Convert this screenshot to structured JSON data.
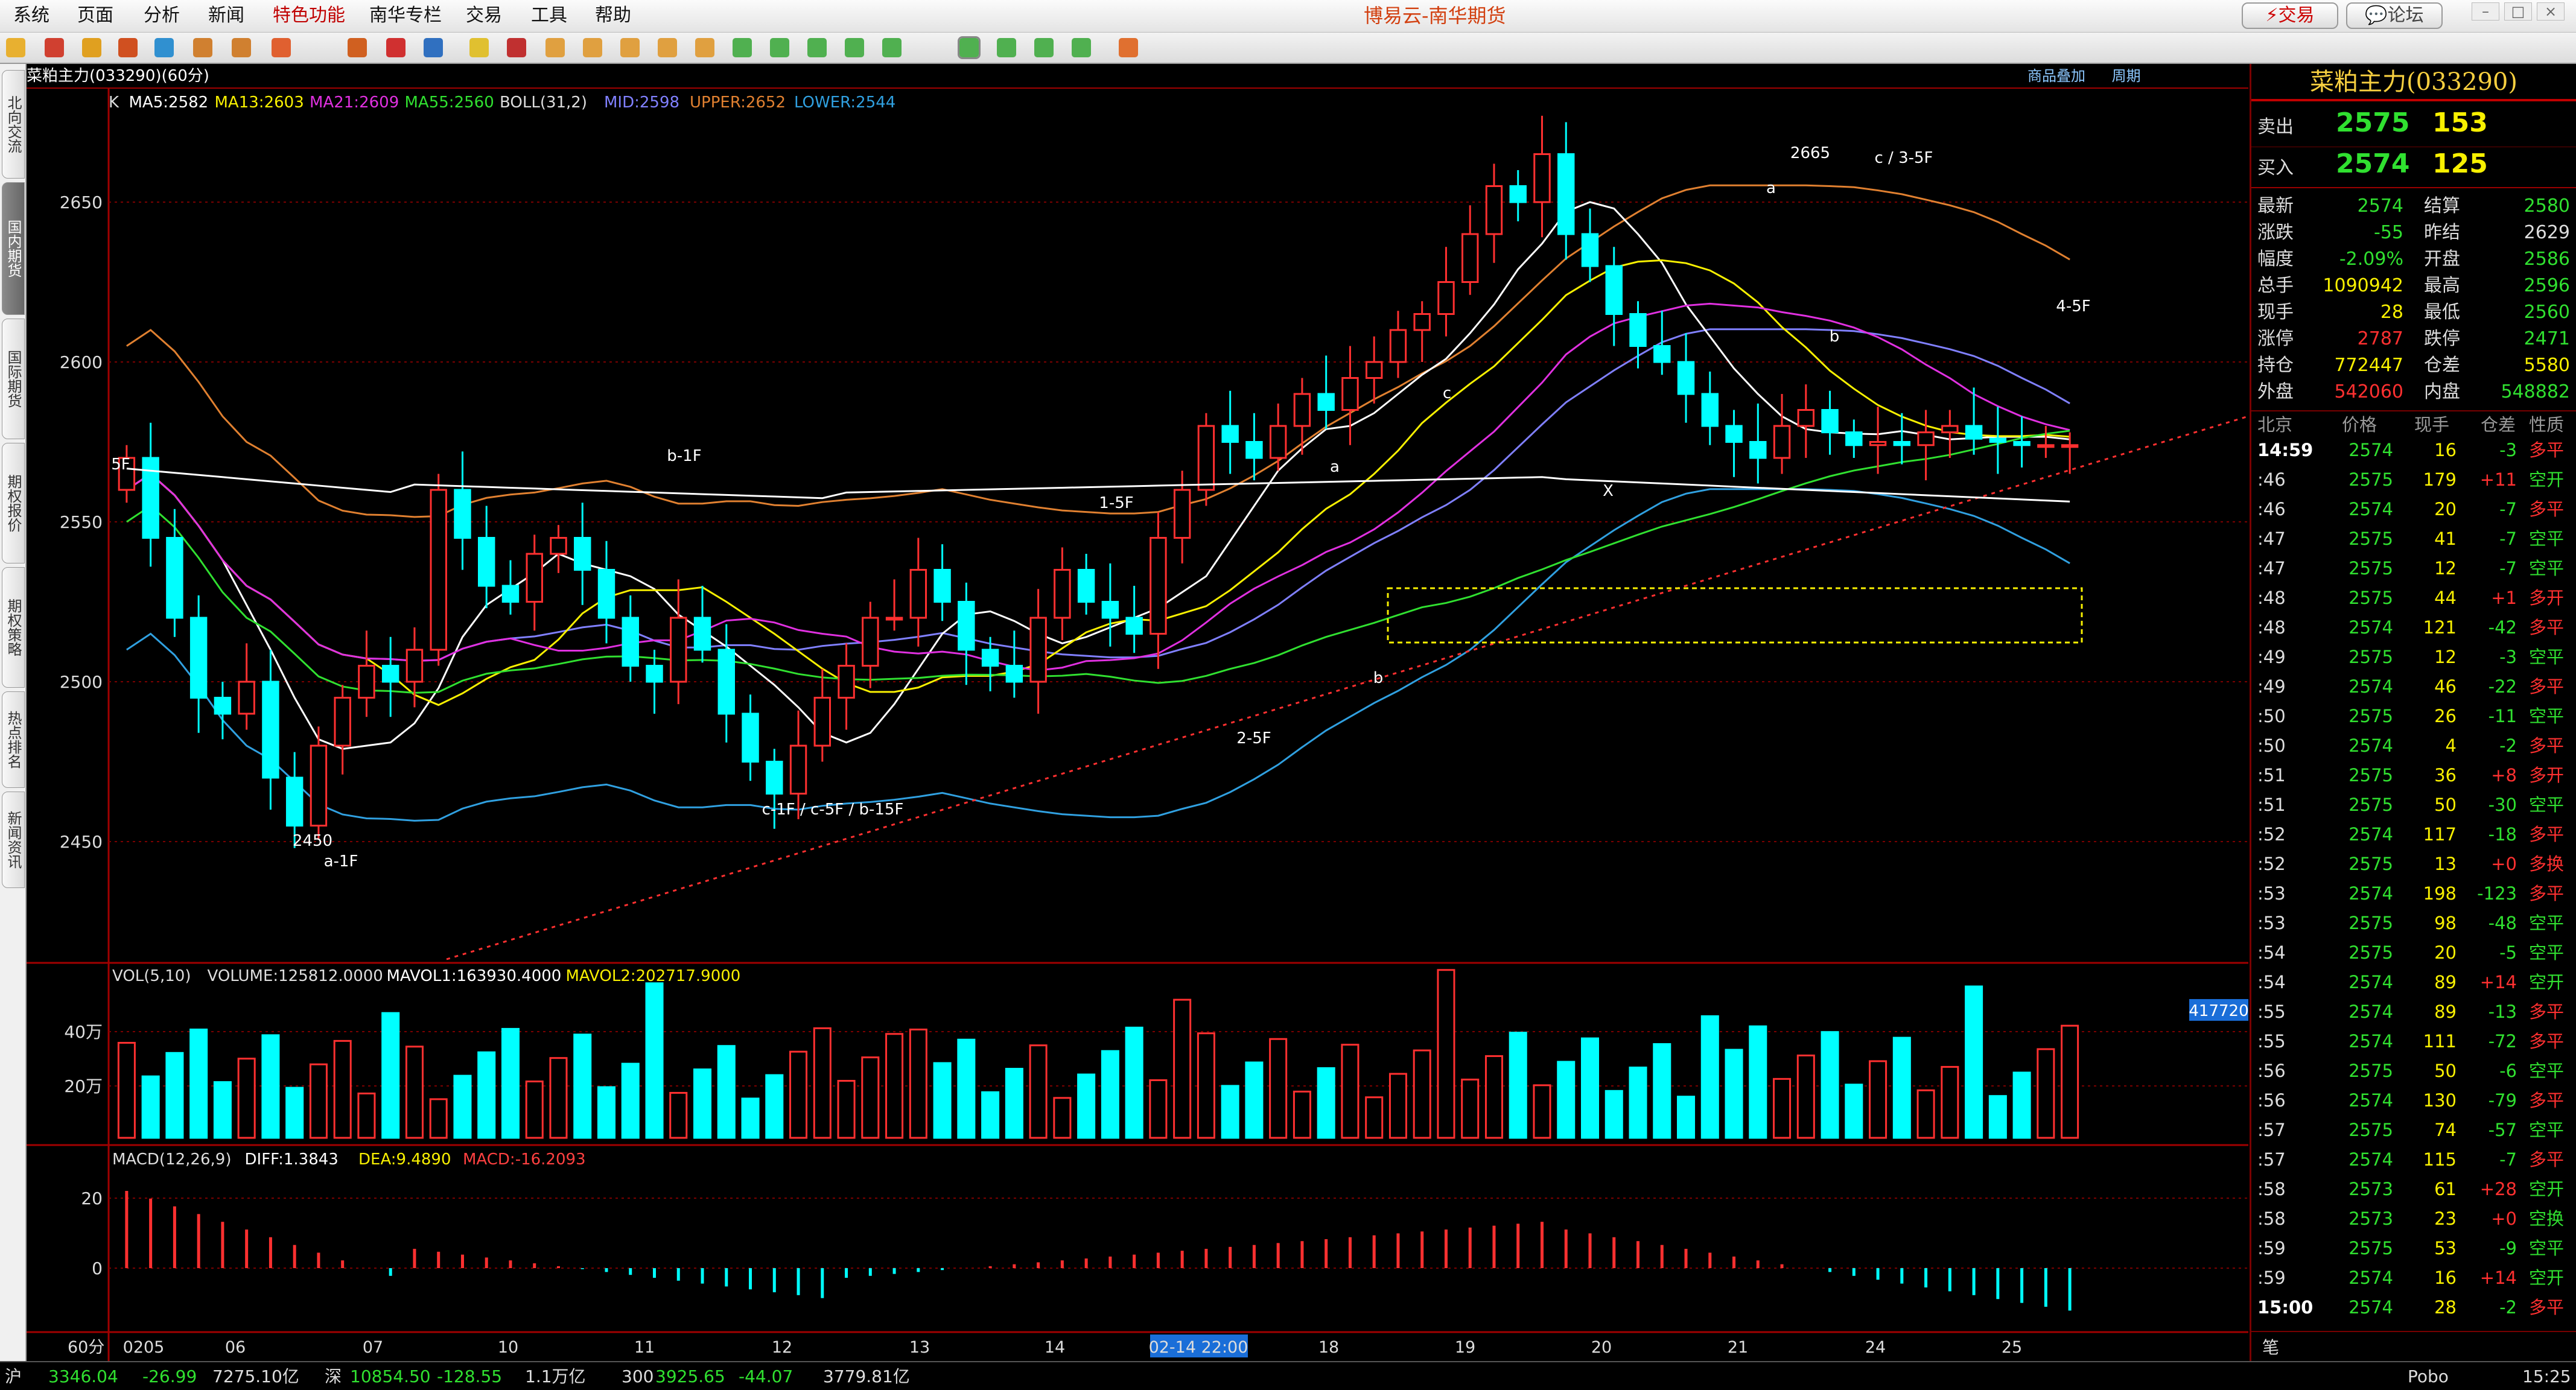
{
  "menubar": {
    "items": [
      "系统",
      "页面",
      "分析",
      "新闻",
      "特色功能",
      "南华专栏",
      "交易",
      "工具",
      "帮助"
    ],
    "app_title": "博易云-南华期货",
    "trade_btn": "交易",
    "forum_btn": "论坛"
  },
  "sidebar": {
    "tabs": [
      "北向交流",
      "国内期货",
      "国际期货",
      "期权报价",
      "期权策略",
      "热点排名",
      "新闻资讯"
    ],
    "active_index": 1
  },
  "chart": {
    "header_title": "菜粕主力(033290)(60分)",
    "tabs": [
      "商品叠加",
      "周期"
    ],
    "main_legend": [
      {
        "t": "K",
        "c": "#dddddd"
      },
      {
        "t": "MA5:2582",
        "c": "#ffffff"
      },
      {
        "t": "MA13:2603",
        "c": "#f8f000"
      },
      {
        "t": "MA21:2609",
        "c": "#e030e0"
      },
      {
        "t": "MA55:2560",
        "c": "#30e030"
      },
      {
        "t": "BOLL(31,2)",
        "c": "#dddddd"
      },
      {
        "t": "MID:2598",
        "c": "#8080ff"
      },
      {
        "t": "UPPER:2652",
        "c": "#e08030"
      },
      {
        "t": "LOWER:2544",
        "c": "#30a0e0"
      }
    ],
    "price_ticks": [
      "2650",
      "2600",
      "2550",
      "2500",
      "2450"
    ],
    "annotations": [
      "2665",
      "c / 3-5F",
      "a",
      "b",
      "4-5F",
      "c",
      "X",
      "a",
      "b",
      "1-5F",
      "2-5F",
      "b-1F",
      "c-1F / c-5F / b-15F",
      "2450",
      "a-1F",
      "5F"
    ],
    "vol_legend": [
      {
        "t": "VOL(5,10)",
        "c": "#dddddd"
      },
      {
        "t": "VOLUME:125812.0000",
        "c": "#dddddd"
      },
      {
        "t": "MAVOL1:163930.4000",
        "c": "#ffffff"
      },
      {
        "t": "MAVOL2:202717.9000",
        "c": "#f8f000"
      }
    ],
    "vol_ticks": [
      "40万",
      "20万"
    ],
    "vol_tag": "417720",
    "macd_legend": [
      {
        "t": "MACD(12,26,9)",
        "c": "#dddddd"
      },
      {
        "t": "DIFF:1.3843",
        "c": "#ffffff"
      },
      {
        "t": "DEA:9.4890",
        "c": "#f8f000"
      },
      {
        "t": "MACD:-16.2093",
        "c": "#ff4040"
      }
    ],
    "macd_ticks": [
      "20",
      "0"
    ],
    "period": "60分",
    "time_labels": [
      "0205",
      "06",
      "07",
      "10",
      "11",
      "12",
      "13",
      "14",
      "02-14 22:00",
      "18",
      "19",
      "20",
      "21",
      "24",
      "25"
    ]
  },
  "quote": {
    "title": "菜粕主力(033290)",
    "sell_label": "卖出",
    "sell_price": "2575",
    "sell_vol": "153",
    "buy_label": "买入",
    "buy_price": "2574",
    "buy_vol": "125",
    "stats": [
      [
        {
          "l": "最新",
          "v": "2574",
          "c": "#30e030"
        },
        {
          "l": "结算",
          "v": "2580",
          "c": "#30e030"
        }
      ],
      [
        {
          "l": "涨跌",
          "v": "-55",
          "c": "#30e030"
        },
        {
          "l": "昨结",
          "v": "2629",
          "c": "#dddddd"
        }
      ],
      [
        {
          "l": "幅度",
          "v": "-2.09%",
          "c": "#30e030"
        },
        {
          "l": "开盘",
          "v": "2586",
          "c": "#30e030"
        }
      ],
      [
        {
          "l": "总手",
          "v": "1090942",
          "c": "#f8f000"
        },
        {
          "l": "最高",
          "v": "2596",
          "c": "#30e030"
        }
      ],
      [
        {
          "l": "现手",
          "v": "28",
          "c": "#f8f000"
        },
        {
          "l": "最低",
          "v": "2560",
          "c": "#30e030"
        }
      ],
      [
        {
          "l": "涨停",
          "v": "2787",
          "c": "#ff3030"
        },
        {
          "l": "跌停",
          "v": "2471",
          "c": "#30e030"
        }
      ],
      [
        {
          "l": "持仓",
          "v": "772447",
          "c": "#f8f000"
        },
        {
          "l": "仓差",
          "v": "5580",
          "c": "#f8f000"
        }
      ],
      [
        {
          "l": "外盘",
          "v": "542060",
          "c": "#ff3030"
        },
        {
          "l": "内盘",
          "v": "548882",
          "c": "#30e030"
        }
      ]
    ],
    "tick_headers": [
      "北京",
      "价格",
      "现手",
      "仓差",
      "性质"
    ],
    "ticks": [
      [
        "14:59",
        "2574",
        "16",
        "-3",
        "多平"
      ],
      [
        ":46",
        "2575",
        "179",
        "+11",
        "空开"
      ],
      [
        ":46",
        "2574",
        "20",
        "-7",
        "多平"
      ],
      [
        ":47",
        "2575",
        "41",
        "-7",
        "空平"
      ],
      [
        ":47",
        "2575",
        "12",
        "-7",
        "空平"
      ],
      [
        ":48",
        "2575",
        "44",
        "+1",
        "多开"
      ],
      [
        ":48",
        "2574",
        "121",
        "-42",
        "多平"
      ],
      [
        ":49",
        "2575",
        "12",
        "-3",
        "空平"
      ],
      [
        ":49",
        "2574",
        "46",
        "-22",
        "多平"
      ],
      [
        ":50",
        "2575",
        "26",
        "-11",
        "空平"
      ],
      [
        ":50",
        "2574",
        "4",
        "-2",
        "多平"
      ],
      [
        ":51",
        "2575",
        "36",
        "+8",
        "多开"
      ],
      [
        ":51",
        "2575",
        "50",
        "-30",
        "空平"
      ],
      [
        ":52",
        "2574",
        "117",
        "-18",
        "多平"
      ],
      [
        ":52",
        "2575",
        "13",
        "+0",
        "多换"
      ],
      [
        ":53",
        "2574",
        "198",
        "-123",
        "多平"
      ],
      [
        ":53",
        "2575",
        "98",
        "-48",
        "空平"
      ],
      [
        ":54",
        "2575",
        "20",
        "-5",
        "空平"
      ],
      [
        ":54",
        "2574",
        "89",
        "+14",
        "空开"
      ],
      [
        ":55",
        "2574",
        "89",
        "-13",
        "多平"
      ],
      [
        ":55",
        "2574",
        "111",
        "-72",
        "多平"
      ],
      [
        ":56",
        "2575",
        "50",
        "-6",
        "空平"
      ],
      [
        ":56",
        "2574",
        "130",
        "-79",
        "多平"
      ],
      [
        ":57",
        "2575",
        "74",
        "-57",
        "空平"
      ],
      [
        ":57",
        "2574",
        "115",
        "-7",
        "多平"
      ],
      [
        ":58",
        "2573",
        "61",
        "+28",
        "空开"
      ],
      [
        ":58",
        "2573",
        "23",
        "+0",
        "空换"
      ],
      [
        ":59",
        "2575",
        "53",
        "-9",
        "空平"
      ],
      [
        ":59",
        "2574",
        "16",
        "+14",
        "空开"
      ],
      [
        "15:00",
        "2574",
        "28",
        "-2",
        "多平"
      ]
    ],
    "footer_tab": "笔"
  },
  "statusbar": [
    {
      "t": "沪",
      "c": "#dddddd"
    },
    {
      "t": "3346.04",
      "c": "#30e030"
    },
    {
      "t": "-26.99",
      "c": "#30e030"
    },
    {
      "t": "7275.10亿",
      "c": "#dddddd"
    },
    {
      "t": "深",
      "c": "#dddddd"
    },
    {
      "t": "10854.50",
      "c": "#30e030"
    },
    {
      "t": "-128.55",
      "c": "#30e030"
    },
    {
      "t": "1.1万亿",
      "c": "#dddddd"
    },
    {
      "t": "300",
      "c": "#dddddd"
    },
    {
      "t": "3925.65",
      "c": "#30e030"
    },
    {
      "t": "-44.07",
      "c": "#30e030"
    },
    {
      "t": "3779.81亿",
      "c": "#dddddd"
    },
    {
      "t": "Pobo",
      "c": "#dddddd"
    },
    {
      "t": "15:25",
      "c": "#dddddd"
    }
  ]
}
